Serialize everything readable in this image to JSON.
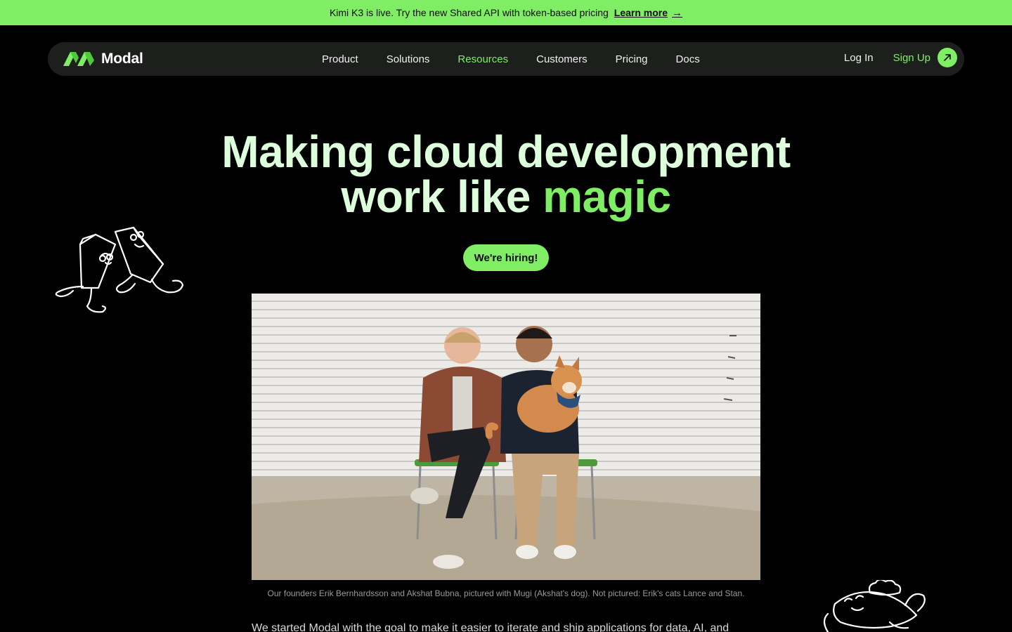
{
  "banner": {
    "text": "Kimi K3 is live. Try the new Shared API with token-based pricing",
    "link_label": "Learn more",
    "arrow_icon": "arrow-right-icon"
  },
  "nav": {
    "logo_text": "Modal",
    "items": [
      {
        "label": "Product"
      },
      {
        "label": "Solutions"
      },
      {
        "label": "Resources",
        "active": true
      },
      {
        "label": "Customers"
      },
      {
        "label": "Pricing"
      },
      {
        "label": "Docs"
      }
    ],
    "login_label": "Log In",
    "signup_label": "Sign Up",
    "signup_icon": "arrow-up-right-icon"
  },
  "hero": {
    "line1": "Making cloud development",
    "line2_prefix": "work like ",
    "line2_highlight": "magic"
  },
  "cta": {
    "hiring_label": "We're hiring!"
  },
  "photo": {
    "caption": "Our founders Erik Bernhardsson and Akshat Bubna, pictured with Mugi (Akshat's dog). Not pictured: Erik's cats Lance and Stan."
  },
  "body": {
    "intro": "We started Modal with the goal to make it easier to iterate and ship applications for data, AI, and"
  },
  "colors": {
    "accent": "#7fee64",
    "hero_text": "#ddffdc",
    "nav_bg": "#1d1f1d",
    "page_bg": "#000000"
  }
}
